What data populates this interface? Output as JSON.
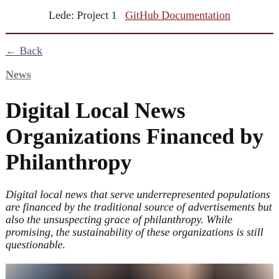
{
  "nav": {
    "project_title": "Lede: Project 1",
    "docs_link": "GitHub Documentation"
  },
  "back_link": "← Back",
  "category": "News",
  "article": {
    "title": "Digital Local News Organizations Financed by Philanthropy",
    "lede": "Digital local news that serve underrepresented populations are financed by the traditional source of advertisements but also the unsuspecting grace of philanthropy. While promising, the sustainability of these organizations is still questionable."
  },
  "colors": {
    "link_accent": "#8b1a1a",
    "divider": "#7b1d1d",
    "back_link": "#4a4a78",
    "category": "#777777"
  }
}
